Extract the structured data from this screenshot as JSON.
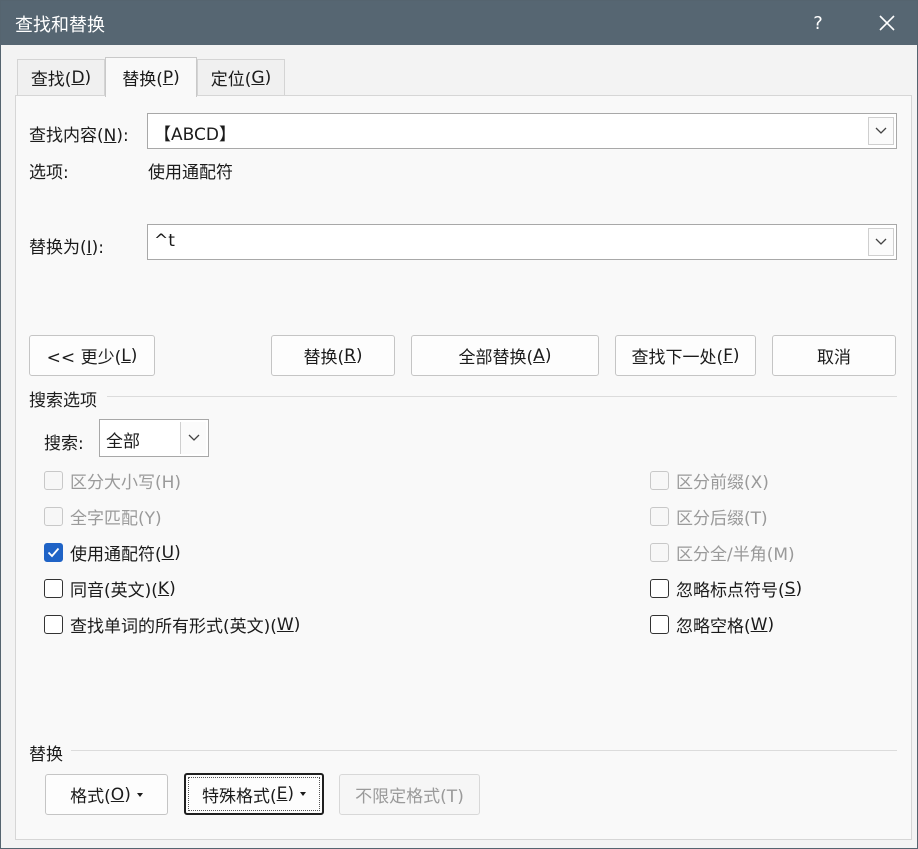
{
  "window": {
    "title": "查找和替换",
    "help": "?"
  },
  "tabs": [
    {
      "pre": "查找(",
      "key": "D",
      "post": ")"
    },
    {
      "pre": "替换(",
      "key": "P",
      "post": ")"
    },
    {
      "pre": "定位(",
      "key": "G",
      "post": ")"
    }
  ],
  "find": {
    "label_pre": "查找内容(",
    "key": "N",
    "label_post": "):",
    "value": "【ABCD】"
  },
  "options": {
    "label": "选项:",
    "value": "使用通配符"
  },
  "replace": {
    "label_pre": "替换为(",
    "key": "I",
    "label_post": "):",
    "value": "^t"
  },
  "buttons": {
    "less": {
      "pre": "<< 更少(",
      "key": "L",
      "post": ")"
    },
    "replace": {
      "pre": "替换(",
      "key": "R",
      "post": ")"
    },
    "replace_all": {
      "pre": "全部替换(",
      "key": "A",
      "post": ")"
    },
    "find_next": {
      "pre": "查找下一处(",
      "key": "F",
      "post": ")"
    },
    "cancel": "取消"
  },
  "search_options": {
    "title": "搜索选项",
    "search_label": "搜索:",
    "search_value": "全部",
    "left": [
      {
        "pre": "区分大小写(H)",
        "key": "",
        "post": "",
        "checked": false,
        "disabled": true
      },
      {
        "pre": "全字匹配(Y)",
        "key": "",
        "post": "",
        "checked": false,
        "disabled": true
      },
      {
        "pre": "使用通配符(",
        "key": "U",
        "post": ")",
        "checked": true,
        "disabled": false
      },
      {
        "pre": "同音(英文)(",
        "key": "K",
        "post": ")",
        "checked": false,
        "disabled": false
      },
      {
        "pre": "查找单词的所有形式(英文)(",
        "key": "W",
        "post": ")",
        "checked": false,
        "disabled": false
      }
    ],
    "right": [
      {
        "pre": "区分前缀(X)",
        "key": "",
        "post": "",
        "checked": false,
        "disabled": true
      },
      {
        "pre": "区分后缀(T)",
        "key": "",
        "post": "",
        "checked": false,
        "disabled": true
      },
      {
        "pre": "区分全/半角(M)",
        "key": "",
        "post": "",
        "checked": false,
        "disabled": true
      },
      {
        "pre": "忽略标点符号(",
        "key": "S",
        "post": ")",
        "checked": false,
        "disabled": false
      },
      {
        "pre": "忽略空格(",
        "key": "W",
        "post": ")",
        "checked": false,
        "disabled": false
      }
    ]
  },
  "replace_section": {
    "title": "替换",
    "format": {
      "pre": "格式(",
      "key": "O",
      "post": ")"
    },
    "special": {
      "pre": "特殊格式(",
      "key": "E",
      "post": ")"
    },
    "no_format": "不限定格式(T)"
  }
}
